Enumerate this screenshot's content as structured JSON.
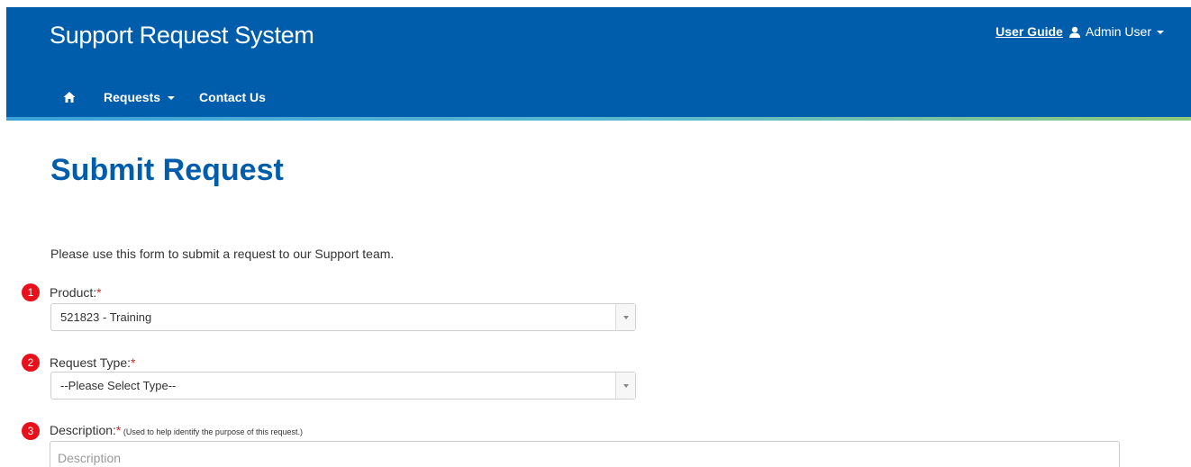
{
  "header": {
    "brand": "Support Request System",
    "user_guide": "User Guide",
    "user_name": "Admin User",
    "nav": {
      "home_icon": "home-icon",
      "requests": "Requests",
      "contact": "Contact Us"
    }
  },
  "page": {
    "title": "Submit Request",
    "intro": "Please use this form to submit a request to our Support team."
  },
  "form": {
    "product": {
      "step": "1",
      "label": "Product:",
      "required": "*",
      "value": "521823 - Training"
    },
    "request_type": {
      "step": "2",
      "label": "Request Type:",
      "required": "*",
      "value": "--Please Select Type--"
    },
    "description": {
      "step": "3",
      "label": "Description:",
      "required": "*",
      "hint": " (Used to help identify the purpose of this request.)",
      "placeholder": "Description"
    }
  },
  "colors": {
    "brand_blue": "#005dab",
    "badge_red": "#e8101a",
    "required_red": "#c9302c"
  }
}
